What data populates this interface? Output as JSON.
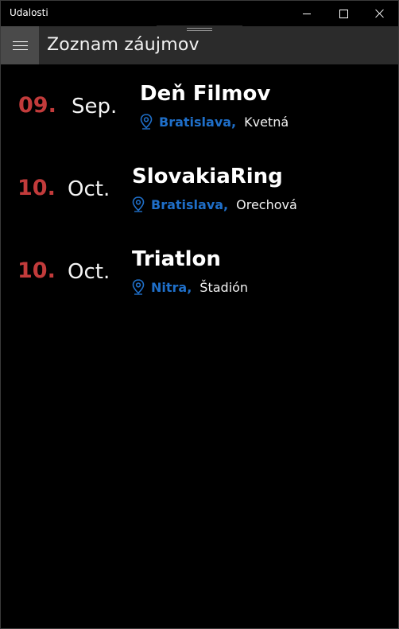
{
  "window": {
    "title": "Udalosti"
  },
  "header": {
    "title": "Zoznam záujmov",
    "menu_icon": "hamburger-icon"
  },
  "colors": {
    "day": "#c23b3b",
    "city": "#1f6fc9",
    "header_bg": "#2b2b2b",
    "menu_bg": "#4a4a4a",
    "background": "#000000"
  },
  "events": [
    {
      "day": "09.",
      "month": "Sep.",
      "name": "Deň Filmov",
      "city": "Bratislava,",
      "place": "Kvetná",
      "icon": "location-pin-icon"
    },
    {
      "day": "10.",
      "month": "Oct.",
      "name": "SlovakiaRing",
      "city": "Bratislava,",
      "place": "Orechová",
      "icon": "location-pin-icon"
    },
    {
      "day": "10.",
      "month": "Oct.",
      "name": "Triatlon",
      "city": "Nitra,",
      "place": "Štadión",
      "icon": "location-pin-icon"
    }
  ]
}
